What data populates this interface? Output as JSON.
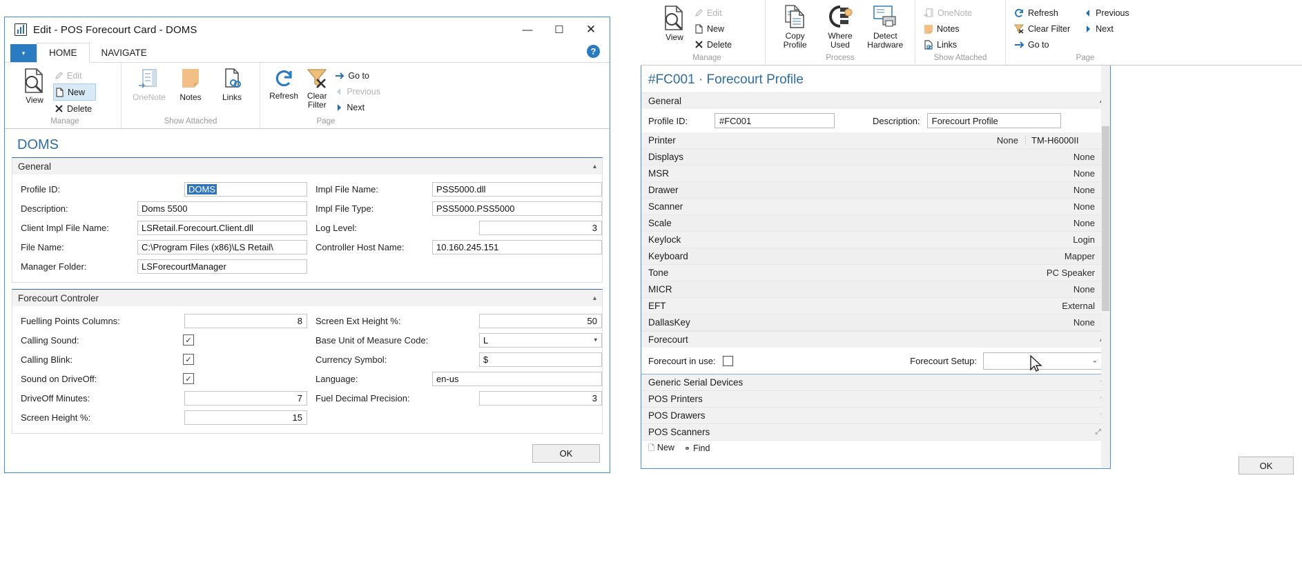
{
  "left_window": {
    "title": "Edit - POS Forecourt Card - DOMS",
    "window_buttons": {
      "minimize": "—",
      "maximize": "☐",
      "close": "✕"
    },
    "quick_access_label": "▾",
    "help_label": "?",
    "tabs": [
      {
        "label": "HOME",
        "active": true
      },
      {
        "label": "NAVIGATE",
        "active": false
      }
    ],
    "ribbon_groups": [
      {
        "name": "Manage",
        "big": [
          {
            "label": "View",
            "icon": "view-magnifier-icon",
            "dim": false
          }
        ],
        "small": [
          {
            "label": "Edit",
            "icon": "pencil-icon",
            "dim": true,
            "selected": false
          },
          {
            "label": "New",
            "icon": "new-page-icon",
            "dim": false,
            "selected": true
          },
          {
            "label": "Delete",
            "icon": "x-delete-icon",
            "dim": false,
            "selected": false
          }
        ]
      },
      {
        "name": "Show Attached",
        "big": [
          {
            "label": "OneNote",
            "icon": "onenote-icon",
            "dim": true
          },
          {
            "label": "Notes",
            "icon": "notes-icon",
            "dim": false
          },
          {
            "label": "Links",
            "icon": "links-icon",
            "dim": false
          }
        ],
        "small": []
      },
      {
        "name": "Page",
        "big": [
          {
            "label": "Refresh",
            "icon": "refresh-icon",
            "dim": false
          },
          {
            "label": "Clear Filter",
            "icon": "clear-filter-icon",
            "dim": false
          }
        ],
        "small": [
          {
            "label": "Go to",
            "icon": "goto-arrow-icon",
            "dim": false,
            "selected": false
          },
          {
            "label": "Previous",
            "icon": "previous-arrow-icon",
            "dim": true,
            "selected": false
          },
          {
            "label": "Next",
            "icon": "next-arrow-icon",
            "dim": false,
            "selected": false
          }
        ]
      }
    ],
    "page_title": "DOMS",
    "sections": [
      {
        "title": "General",
        "collapse_icon": "▴",
        "left_fields": [
          {
            "label": "Profile ID:",
            "value": "DOMS",
            "type": "text-selected"
          },
          {
            "label": "Description:",
            "value": "Doms 5500",
            "type": "text"
          },
          {
            "label": "Client Impl File Name:",
            "value": "LSRetail.Forecourt.Client.dll",
            "type": "text"
          },
          {
            "label": "File Name:",
            "value": "C:\\Program Files (x86)\\LS Retail\\",
            "type": "text"
          },
          {
            "label": "Manager Folder:",
            "value": "LSForecourtManager",
            "type": "text"
          }
        ],
        "right_fields": [
          {
            "label": "Impl File Name:",
            "value": "PSS5000.dll",
            "type": "text"
          },
          {
            "label": "Impl File Type:",
            "value": "PSS5000.PSS5000",
            "type": "text"
          },
          {
            "label": "Log Level:",
            "value": "3",
            "type": "number"
          },
          {
            "label": "Controller Host Name:",
            "value": "10.160.245.151",
            "type": "text"
          }
        ]
      },
      {
        "title": "Forecourt Controler",
        "collapse_icon": "▴",
        "left_fields": [
          {
            "label": "Fuelling Points Columns:",
            "value": "8",
            "type": "number"
          },
          {
            "label": "Calling Sound:",
            "value": "✓",
            "type": "checkbox-checked"
          },
          {
            "label": "Calling Blink:",
            "value": "✓",
            "type": "checkbox-checked"
          },
          {
            "label": "Sound on DriveOff:",
            "value": "✓",
            "type": "checkbox-checked"
          },
          {
            "label": "DriveOff Minutes:",
            "value": "7",
            "type": "number"
          },
          {
            "label": "Screen Height %:",
            "value": "15",
            "type": "number"
          }
        ],
        "right_fields": [
          {
            "label": "Screen Ext Height %:",
            "value": "50",
            "type": "number"
          },
          {
            "label": "Base Unit of Measure Code:",
            "value": "L",
            "type": "dropdown"
          },
          {
            "label": "Currency Symbol:",
            "value": "$",
            "type": "text"
          },
          {
            "label": "Language:",
            "value": "en-us",
            "type": "text"
          },
          {
            "label": "Fuel Decimal Precision:",
            "value": "3",
            "type": "number"
          }
        ]
      }
    ],
    "ok_label": "OK"
  },
  "right_window": {
    "ribbon_groups": [
      {
        "name": "Manage",
        "big": [
          {
            "label": "View",
            "icon": "view-magnifier-icon",
            "dim": false
          }
        ],
        "small": [
          {
            "label": "Edit",
            "icon": "pencil-icon",
            "dim": true
          },
          {
            "label": "New",
            "icon": "new-page-icon",
            "dim": false
          },
          {
            "label": "Delete",
            "icon": "x-delete-icon",
            "dim": false
          }
        ]
      },
      {
        "name": "Process",
        "big": [
          {
            "label": "Copy Profile",
            "icon": "copy-profile-icon",
            "dim": false
          },
          {
            "label": "Where Used",
            "icon": "where-used-icon",
            "dim": false
          },
          {
            "label": "Detect Hardware",
            "icon": "detect-hardware-icon",
            "dim": false
          }
        ],
        "small": []
      },
      {
        "name": "Show Attached",
        "big": [],
        "small": [
          {
            "label": "OneNote",
            "icon": "onenote-icon",
            "dim": true
          },
          {
            "label": "Notes",
            "icon": "notes-icon",
            "dim": false
          },
          {
            "label": "Links",
            "icon": "links-icon",
            "dim": false
          }
        ]
      },
      {
        "name": "Page",
        "big": [],
        "small": [
          {
            "label": "Refresh",
            "icon": "refresh-icon",
            "dim": false
          },
          {
            "label": "Clear Filter",
            "icon": "clear-filter-icon",
            "dim": false
          },
          {
            "label": "Go to",
            "icon": "goto-arrow-icon",
            "dim": false
          }
        ],
        "small2": [
          {
            "label": "Previous",
            "icon": "previous-arrow-icon",
            "dim": false
          },
          {
            "label": "Next",
            "icon": "next-arrow-icon",
            "dim": false
          }
        ]
      }
    ],
    "page_title": "#FC001 · Forecourt Profile",
    "general": {
      "title": "General",
      "collapse_icon": "▴",
      "profile_id_label": "Profile ID:",
      "profile_id_value": "#FC001",
      "description_label": "Description:",
      "description_value": "Forecourt Profile"
    },
    "device_rows": [
      {
        "name": "Printer",
        "value": "None",
        "value2": "TM-H6000II",
        "caret": "▾"
      },
      {
        "name": "Displays",
        "value": "None",
        "value2": "",
        "caret": "▾"
      },
      {
        "name": "MSR",
        "value": "None",
        "value2": "",
        "caret": "▾"
      },
      {
        "name": "Drawer",
        "value": "None",
        "value2": "",
        "caret": "▾"
      },
      {
        "name": "Scanner",
        "value": "None",
        "value2": "",
        "caret": "▾"
      },
      {
        "name": "Scale",
        "value": "None",
        "value2": "",
        "caret": "▾"
      },
      {
        "name": "Keylock",
        "value": "Login",
        "value2": "",
        "caret": "▾"
      },
      {
        "name": "Keyboard",
        "value": "Mapper",
        "value2": "",
        "caret": "▾"
      },
      {
        "name": "Tone",
        "value": "PC Speaker",
        "value2": "",
        "caret": "▾"
      },
      {
        "name": "MICR",
        "value": "None",
        "value2": "",
        "caret": "▾"
      },
      {
        "name": "EFT",
        "value": "External",
        "value2": "",
        "caret": "▾"
      },
      {
        "name": "DallasKey",
        "value": "None",
        "value2": "",
        "caret": "▾"
      }
    ],
    "forecourt": {
      "title": "Forecourt",
      "collapse_icon": "▴",
      "in_use_label": "Forecourt in use:",
      "in_use_checked": false,
      "setup_label": "Forecourt Setup:",
      "setup_value": "",
      "setup_caret": "⌄"
    },
    "list_rows": [
      {
        "name": "Generic Serial Devices",
        "caret": "▾",
        "selected": true
      },
      {
        "name": "POS Printers",
        "caret": "▾",
        "selected": false
      },
      {
        "name": "POS Drawers",
        "caret": "▾",
        "selected": false
      },
      {
        "name": "POS Scanners",
        "caret": "⤢▴",
        "selected": false
      }
    ],
    "footer_actions": [
      {
        "label": "New",
        "icon": "new-page-icon"
      },
      {
        "label": "Find",
        "icon": "find-binoculars-icon"
      }
    ],
    "ok_label": "OK"
  }
}
